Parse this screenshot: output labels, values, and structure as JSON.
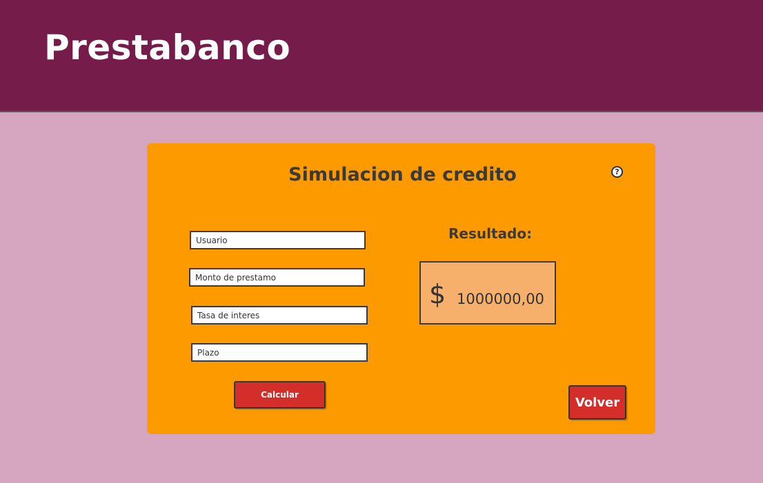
{
  "header": {
    "brand": "Prestabanco"
  },
  "card": {
    "title": "Simulacion de credito",
    "help_symbol": "?",
    "fields": {
      "usuario": {
        "value": "",
        "placeholder": "Usuario"
      },
      "monto": {
        "value": "",
        "placeholder": "Monto de prestamo"
      },
      "tasa": {
        "value": "",
        "placeholder": "Tasa de interes"
      },
      "plazo": {
        "value": "",
        "placeholder": "Plazo"
      }
    },
    "calculate_label": "Calcular",
    "result": {
      "label": "Resultado:",
      "currency": "$",
      "value": "1000000,00"
    },
    "back_label": "Volver"
  },
  "icons": {
    "help": "help-circle-icon",
    "currency": "dollar-icon"
  },
  "colors": {
    "header_bg": "#761c4a",
    "page_bg": "#d6a6c0",
    "card_bg": "#fd9a00",
    "result_bg": "#f6b06b",
    "button_bg": "#d32e2a"
  }
}
